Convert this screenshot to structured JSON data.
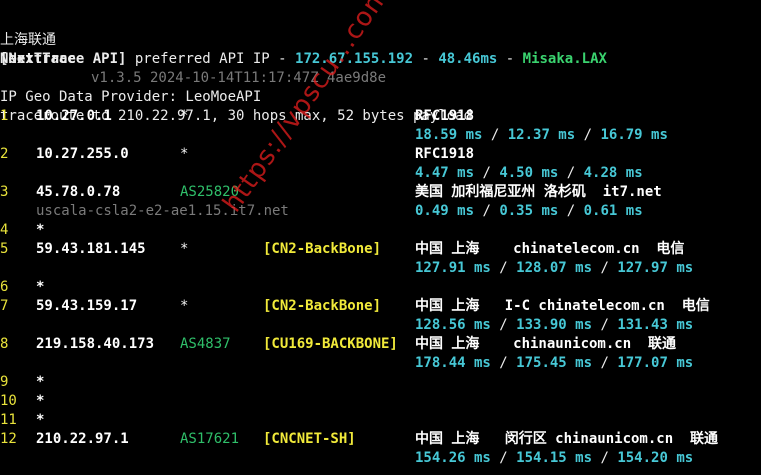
{
  "header": {
    "dashes": "--------------------------------------------------------------------------------------------------",
    "title_cn": "上海联通",
    "app_name": "NextTrace",
    "version_info": "v1.3.5 2024-10-14T11:17:47Z 4ae9d8e",
    "api_prefix": "[NextTrace API]",
    "api_text": " preferred API IP - ",
    "api_ip": "172.67.155.192",
    "api_sep1": " - ",
    "api_latency": "48.46ms",
    "api_sep2": " - ",
    "api_node": "Misaka.LAX",
    "geo_provider": "IP Geo Data Provider: LeoMoeAPI",
    "traceroute_line": "traceroute to 210.22.97.1, 30 hops max, 52 bytes payload"
  },
  "watermark": "https://vpscu...com",
  "hops": [
    {
      "num": "1",
      "ip": "10.27.0.1",
      "asn": "*",
      "tag": "",
      "geo": "RFC1918",
      "rtt1": "18.59 ms",
      "rtt2": "12.37 ms",
      "rtt3": "16.79 ms",
      "hostname": ""
    },
    {
      "num": "2",
      "ip": "10.27.255.0",
      "asn": "*",
      "tag": "",
      "geo": "RFC1918",
      "rtt1": "4.47 ms",
      "rtt2": "4.50 ms",
      "rtt3": "4.28 ms",
      "hostname": ""
    },
    {
      "num": "3",
      "ip": "45.78.0.78",
      "asn": "AS25820",
      "tag": "",
      "geo": "美国 加利福尼亚州 洛杉矶  it7.net",
      "rtt1": "0.49 ms",
      "rtt2": "0.35 ms",
      "rtt3": "0.61 ms",
      "hostname": "uscala-csla2-e2-ae1.15.it7.net"
    },
    {
      "num": "4",
      "ip": "*",
      "asn": "",
      "tag": "",
      "geo": "",
      "rtt1": "",
      "rtt2": "",
      "rtt3": "",
      "hostname": ""
    },
    {
      "num": "5",
      "ip": "59.43.181.145",
      "asn": "*",
      "tag": "[CN2-BackBone]",
      "geo": "中国 上海    chinatelecom.cn  电信",
      "rtt1": "127.91 ms",
      "rtt2": "128.07 ms",
      "rtt3": "127.97 ms",
      "hostname": ""
    },
    {
      "num": "6",
      "ip": "*",
      "asn": "",
      "tag": "",
      "geo": "",
      "rtt1": "",
      "rtt2": "",
      "rtt3": "",
      "hostname": ""
    },
    {
      "num": "7",
      "ip": "59.43.159.17",
      "asn": "*",
      "tag": "[CN2-BackBone]",
      "geo": "中国 上海   I-C chinatelecom.cn  电信",
      "rtt1": "128.56 ms",
      "rtt2": "133.90 ms",
      "rtt3": "131.43 ms",
      "hostname": ""
    },
    {
      "num": "8",
      "ip": "219.158.40.173",
      "asn": "AS4837",
      "tag": "[CU169-BACKBONE]",
      "geo": "中国 上海    chinaunicom.cn  联通",
      "rtt1": "178.44 ms",
      "rtt2": "175.45 ms",
      "rtt3": "177.07 ms",
      "hostname": ""
    },
    {
      "num": "9",
      "ip": "*",
      "asn": "",
      "tag": "",
      "geo": "",
      "rtt1": "",
      "rtt2": "",
      "rtt3": "",
      "hostname": ""
    },
    {
      "num": "10",
      "ip": "*",
      "asn": "",
      "tag": "",
      "geo": "",
      "rtt1": "",
      "rtt2": "",
      "rtt3": "",
      "hostname": ""
    },
    {
      "num": "11",
      "ip": "*",
      "asn": "",
      "tag": "",
      "geo": "",
      "rtt1": "",
      "rtt2": "",
      "rtt3": "",
      "hostname": ""
    },
    {
      "num": "12",
      "ip": "210.22.97.1",
      "asn": "AS17621",
      "tag": "[CNCNET-SH]",
      "geo": "中国 上海   闵行区 chinaunicom.cn  联通",
      "rtt1": "154.26 ms",
      "rtt2": "154.15 ms",
      "rtt3": "154.20 ms",
      "hostname": ""
    }
  ],
  "rtt_separator": " / ",
  "colors": {
    "background": "#000000",
    "text": "#ececec",
    "hop_number": "#e9e33b",
    "asn": "#2fbf6a",
    "tag": "#e9e33b",
    "rtt": "#47c8d6",
    "hostname": "#7a7a7a",
    "watermark": "#e61e1e"
  }
}
